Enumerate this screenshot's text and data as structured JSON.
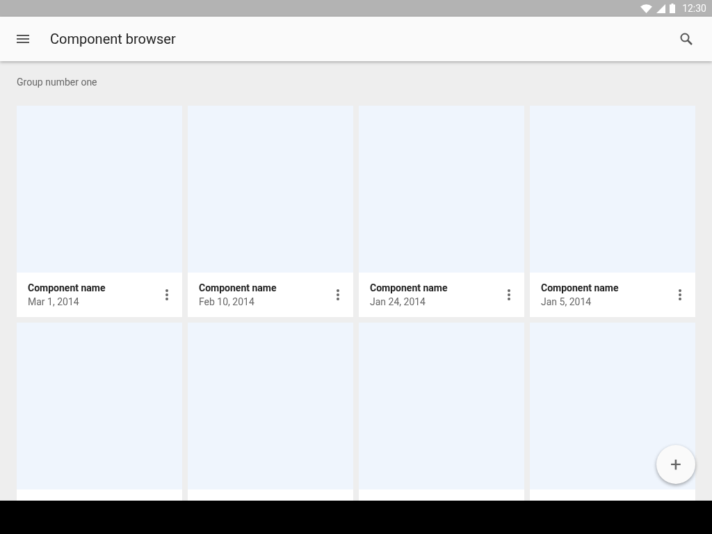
{
  "status_bar": {
    "time": "12:30"
  },
  "app_bar": {
    "title": "Component browser"
  },
  "group": {
    "title": "Group number one"
  },
  "cards": [
    {
      "kind": "full",
      "name": "Component name",
      "date": "Mar 1, 2014"
    },
    {
      "kind": "full",
      "name": "Component name",
      "date": "Feb 10, 2014"
    },
    {
      "kind": "full",
      "name": "Component name",
      "date": "Jan 24, 2014"
    },
    {
      "kind": "full",
      "name": "Component name",
      "date": "Jan 5, 2014"
    },
    {
      "kind": "cut"
    },
    {
      "kind": "cut"
    },
    {
      "kind": "cut"
    },
    {
      "kind": "cut"
    }
  ],
  "fab": {
    "label": "+"
  }
}
